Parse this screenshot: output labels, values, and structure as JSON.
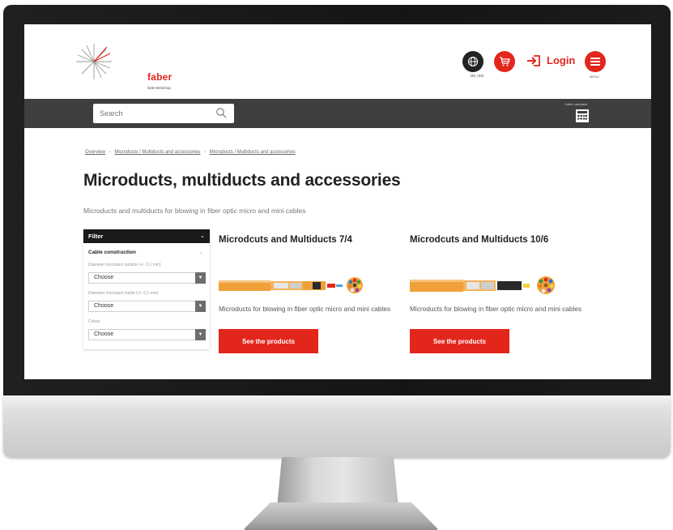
{
  "brand": {
    "name": "faber",
    "sub": "B2B-Webshop"
  },
  "header": {
    "lang": "DE | EN",
    "login_label": "Login",
    "menu_label": "MENU",
    "calc_label": "Cable calculator"
  },
  "search": {
    "placeholder": "Search"
  },
  "breadcrumb": {
    "items": [
      "Overview",
      "Microducts / Multiducts and accessories",
      "Microducts / Multiducts and accessories"
    ],
    "separator": "›"
  },
  "page": {
    "title": "Microducts, multiducts and accessories",
    "subtitle": "Microducts and multiducts for blowing in fiber optic micro and mini cables"
  },
  "filter": {
    "title": "Filter",
    "group": "Cable construction",
    "fields": [
      {
        "label": "Diameter microduct outside (+/- 0,1 mm)",
        "value": "Choose"
      },
      {
        "label": "Diameter microduct inside (+/- 0,1 mm)",
        "value": "Choose"
      },
      {
        "label": "Colour",
        "value": "Choose"
      }
    ]
  },
  "products": [
    {
      "title": "Microdcuts and Multiducts 7/4",
      "desc": "Microducts for blowing in fiber optic micro and mini cables",
      "button": "See the products"
    },
    {
      "title": "Microdcuts and Multiducts 10/6",
      "desc": "Microducts for blowing in fiber optic micro and mini cables",
      "button": "See the products"
    }
  ],
  "colors": {
    "accent": "#e3261c",
    "navbar": "#3e3e3e",
    "dark": "#1a1a1a",
    "cable_orange": "#f0a03a"
  }
}
